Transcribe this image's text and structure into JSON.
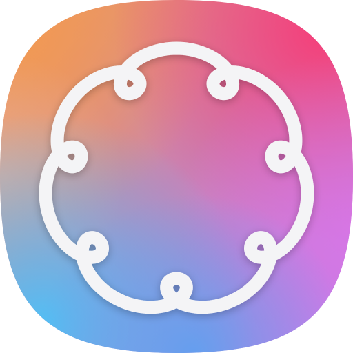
{
  "icon": {
    "semantic": "apple-intelligence-icon",
    "glyph": "seven-lobed-interlaced-star",
    "lobe_count": 7,
    "colors": {
      "glyph": "#F4F4F6",
      "gradient_top_left": "#F29A52",
      "gradient_top_right": "#F63E78",
      "gradient_center": "#C883B5",
      "gradient_right": "#D974E6",
      "gradient_bottom_left": "#52BFF4",
      "gradient_bottom": "#5EA0F0",
      "gradient_bottom_right": "#C17EF2",
      "gradient_left": "#E4B7AC"
    }
  }
}
